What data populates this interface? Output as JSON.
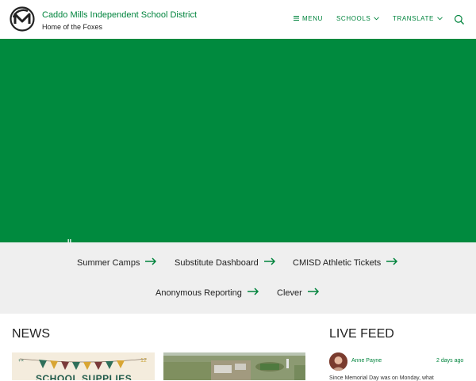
{
  "header": {
    "title": "Caddo Mills Independent School District",
    "subtitle": "Home of the Foxes",
    "nav": {
      "menu": "MENU",
      "schools": "SCHOOLS",
      "translate": "TRANSLATE"
    }
  },
  "quicklinks": [
    {
      "label": "Summer Camps"
    },
    {
      "label": "Substitute Dashboard"
    },
    {
      "label": "CMISD Athletic Tickets"
    },
    {
      "label": "Anonymous Reporting"
    },
    {
      "label": "Clever"
    }
  ],
  "news": {
    "heading": "NEWS",
    "cards": [
      {
        "banner_text": "SCHOOL SUPPLIES"
      }
    ]
  },
  "live_feed": {
    "heading": "LIVE FEED",
    "posts": [
      {
        "author": "Anne Payne",
        "time": "2 days ago",
        "text": "Since Memorial Day was on Monday, what"
      }
    ]
  },
  "colors": {
    "brand_green": "#00843d",
    "hero_green": "#008a3e",
    "quicklinks_bg": "#efefef"
  }
}
